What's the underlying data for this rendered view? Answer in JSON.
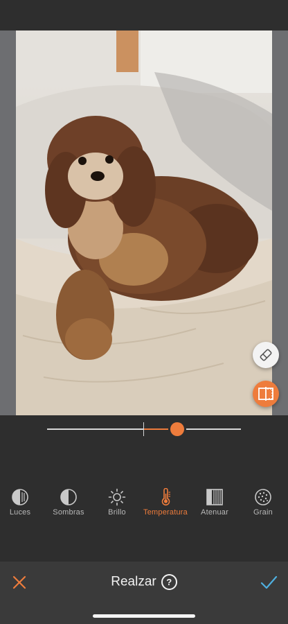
{
  "screen": "Realzar",
  "colors": {
    "accent": "#ee7c3c",
    "background": "#2e2e2e",
    "bottom_bar": "#3a3a3a"
  },
  "photo": {
    "subject": "dog-photo"
  },
  "floating_buttons": [
    {
      "icon": "eraser-icon"
    },
    {
      "icon": "compare-split-icon"
    }
  ],
  "slider": {
    "value": 0.67,
    "center": 0.5
  },
  "tools": [
    {
      "label": "Luces",
      "icon": "half-circle-lines-icon",
      "active": false
    },
    {
      "label": "Sombras",
      "icon": "half-filled-circle-icon",
      "active": false
    },
    {
      "label": "Brillo",
      "icon": "sun-icon",
      "active": false
    },
    {
      "label": "Temperatura",
      "icon": "thermometer-icon",
      "active": true
    },
    {
      "label": "Atenuar",
      "icon": "fade-square-icon",
      "active": false
    },
    {
      "label": "Grain",
      "icon": "grain-dots-icon",
      "active": false
    }
  ],
  "bottom_bar": {
    "title": "Realzar",
    "cancel_icon": "close-icon",
    "help_icon": "help-icon",
    "help_glyph": "?",
    "confirm_icon": "checkmark-icon"
  }
}
